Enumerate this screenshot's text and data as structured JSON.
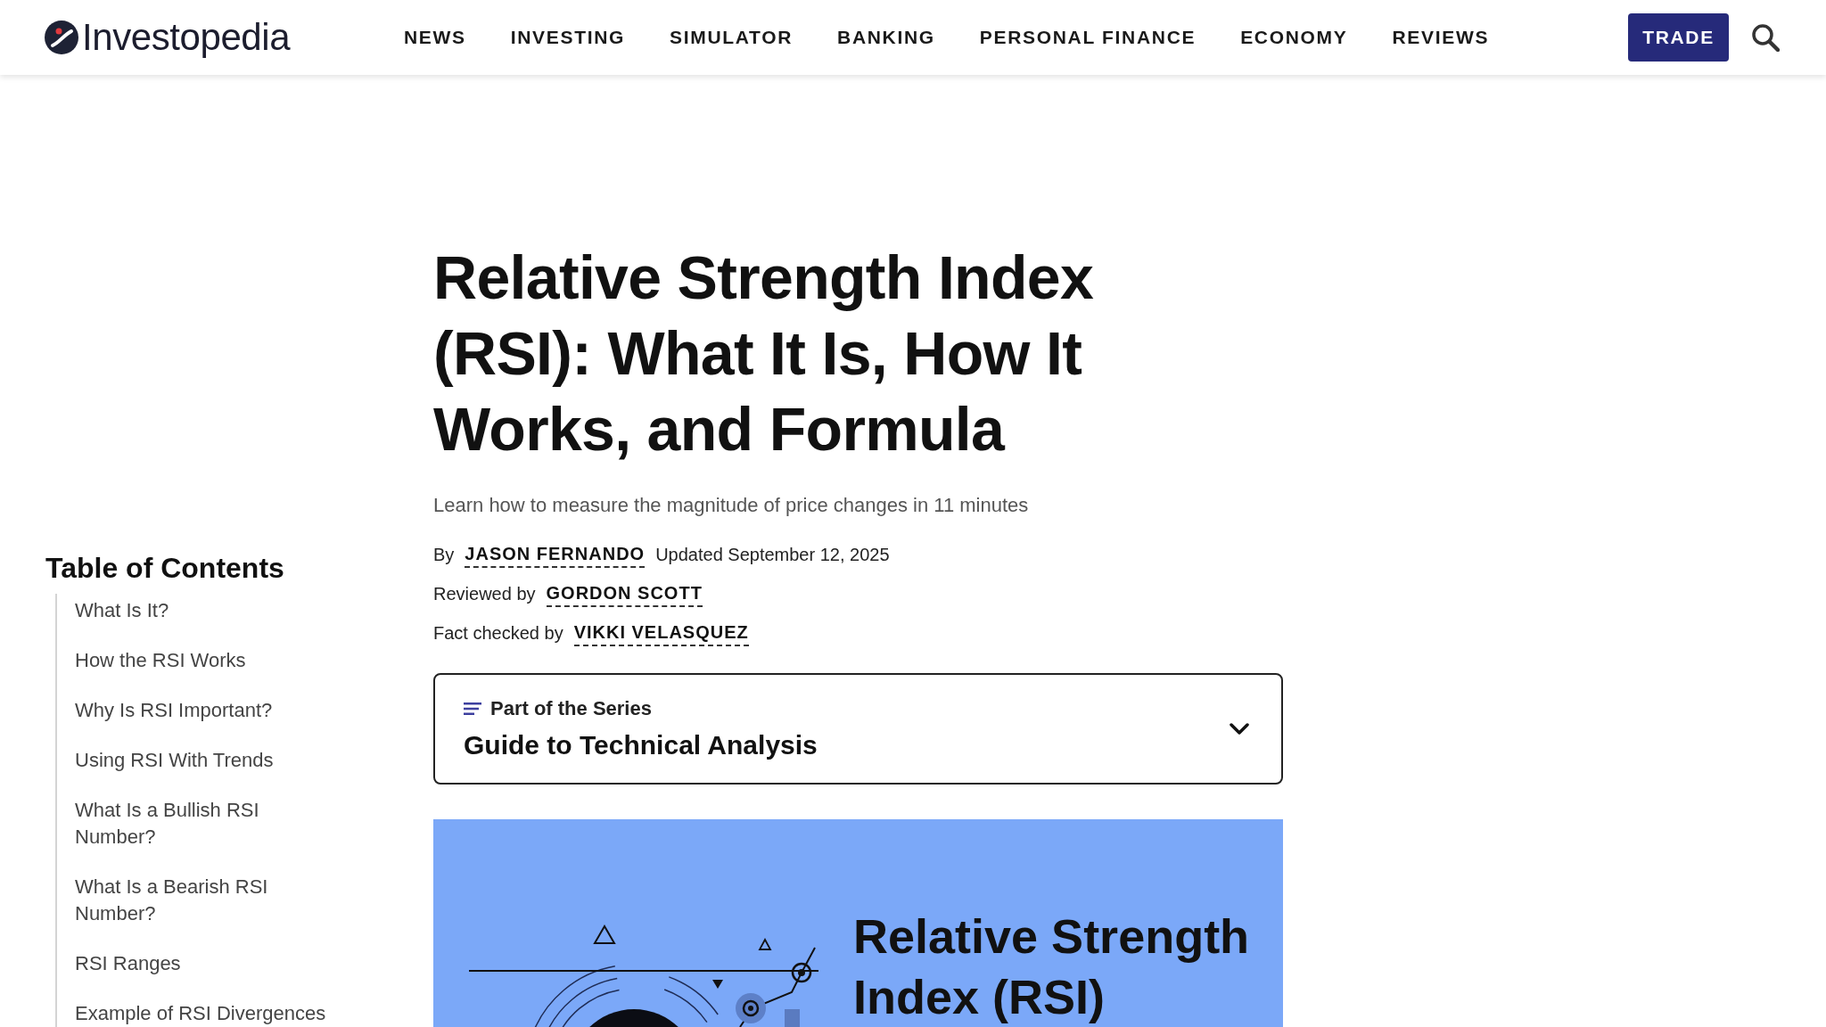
{
  "header": {
    "logo": "Investopedia",
    "nav": [
      "NEWS",
      "INVESTING",
      "SIMULATOR",
      "BANKING",
      "PERSONAL FINANCE",
      "ECONOMY",
      "REVIEWS"
    ],
    "trade_button": "TRADE"
  },
  "toc": {
    "title": "Table of Contents",
    "items": [
      "What Is It?",
      "How the RSI Works",
      "Why Is RSI Important?",
      "Using RSI With Trends",
      "What Is a Bullish RSI Number?",
      "What Is a Bearish RSI Number?",
      "RSI Ranges",
      "Example of RSI Divergences"
    ]
  },
  "article": {
    "title": "Relative Strength Index (RSI): What It Is, How It Works, and Formula",
    "subtitle": "Learn how to measure the magnitude of price changes in 11 minutes",
    "byline": [
      {
        "role": "By",
        "name": "JASON FERNANDO",
        "note": "Updated September 12, 2025"
      },
      {
        "role": "Reviewed by",
        "name": "GORDON SCOTT"
      },
      {
        "role": "Fact checked by",
        "name": "VIKKI VELASQUEZ"
      }
    ],
    "series": {
      "label": "Part of the Series",
      "title": "Guide to Technical Analysis",
      "expanded": false
    },
    "hero_image": {
      "title": "Relative Strength Index (RSI)"
    }
  }
}
